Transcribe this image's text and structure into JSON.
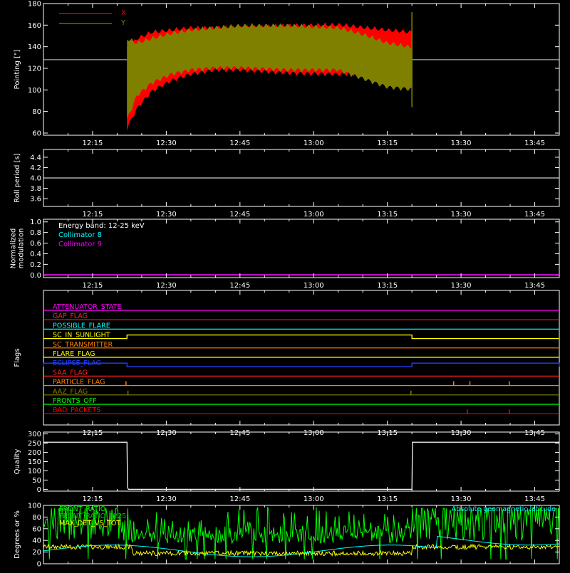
{
  "chart_data": [
    {
      "type": "area",
      "ylabel": "Pointing [\"]",
      "ylim": [
        58,
        180
      ],
      "yticks": [
        60,
        80,
        100,
        120,
        140,
        160,
        180
      ],
      "xlim_minutes": [
        0,
        105
      ],
      "xtick_labels": [
        "12:15",
        "12:30",
        "12:45",
        "13:00",
        "13:15",
        "13:30",
        "13:45"
      ],
      "xtick_minutes": [
        10,
        25,
        40,
        55,
        70,
        85,
        100
      ],
      "reference_line": 128,
      "data_span_minutes": [
        17,
        75
      ],
      "series": [
        {
          "name": "X",
          "color": "#ff0000",
          "x": [
            17,
            19,
            22,
            26,
            30,
            35,
            40,
            50,
            60,
            70,
            75
          ],
          "upper": [
            140,
            150,
            156,
            158,
            160,
            160,
            160,
            162,
            163,
            158,
            156
          ],
          "lower": [
            62,
            80,
            96,
            106,
            112,
            116,
            116,
            113,
            112,
            114,
            116
          ]
        },
        {
          "name": "Y",
          "color": "#808000",
          "x": [
            17,
            19,
            22,
            26,
            30,
            35,
            40,
            50,
            60,
            65,
            70,
            75
          ],
          "upper": [
            150,
            146,
            150,
            155,
            158,
            160,
            162,
            162,
            160,
            154,
            146,
            142
          ],
          "lower": [
            70,
            92,
            104,
            112,
            116,
            118,
            118,
            116,
            116,
            108,
            100,
            98
          ]
        }
      ]
    },
    {
      "type": "line",
      "ylabel": "Roll period [s]",
      "ylim": [
        3.45,
        4.55
      ],
      "yticks": [
        3.6,
        3.8,
        4.0,
        4.2,
        4.4
      ],
      "ytick_labels": [
        "3.6",
        "3.8",
        "4.0",
        "4.2",
        "4.4"
      ],
      "xtick_labels": [
        "12:15",
        "12:30",
        "12:45",
        "13:00",
        "13:15",
        "13:30",
        "13:45"
      ],
      "series": [
        {
          "name": "",
          "color": "#ffffff",
          "x": [
            0,
            105
          ],
          "values": [
            4.0,
            4.0
          ]
        }
      ]
    },
    {
      "type": "line",
      "ylabel": "Normalized modulation",
      "ylabel_lines": [
        "Normalized",
        "modulation"
      ],
      "ylim": [
        -0.05,
        1.05
      ],
      "yticks": [
        0.0,
        0.2,
        0.4,
        0.6,
        0.8,
        1.0
      ],
      "ytick_labels": [
        "0.0",
        "0.2",
        "0.4",
        "0.6",
        "0.8",
        "1.0"
      ],
      "xtick_labels": [
        "12:15",
        "12:30",
        "12:45",
        "13:00",
        "13:15",
        "13:30",
        "13:45"
      ],
      "legend_text": "Energy band: 12-25 keV",
      "series": [
        {
          "name": "Collimator 8",
          "color": "#00ffff",
          "x": [
            0,
            105
          ],
          "values": [
            0.0,
            0.0
          ]
        },
        {
          "name": "Collimator 9",
          "color": "#ff00ff",
          "x": [
            0,
            105
          ],
          "values": [
            0.0,
            0.0
          ]
        }
      ]
    },
    {
      "type": "line",
      "ylabel": "Flags",
      "xtick_labels": [
        "12:15",
        "12:30",
        "12:45",
        "13:00",
        "13:15",
        "13:30",
        "13:45"
      ],
      "flags": [
        {
          "name": "ATTENUATOR_STATE",
          "color": "#ff00ff",
          "on": []
        },
        {
          "name": "GAP_FLAG",
          "color": "#ff2020",
          "on": []
        },
        {
          "name": "POSSIBLE_FLARE",
          "color": "#00ffff",
          "on": []
        },
        {
          "name": "SC_IN_SUNLIGHT",
          "color": "#ffff00",
          "on": [
            [
              17,
              75
            ]
          ]
        },
        {
          "name": "SC_TRANSMITTER",
          "color": "#ff8000",
          "on": []
        },
        {
          "name": "FLARE_FLAG",
          "color": "#ffff00",
          "on": []
        },
        {
          "name": "ECLIPSE_FLAG",
          "color": "#2040ff",
          "on": [
            [
              0,
              17
            ],
            [
              75,
              105
            ]
          ]
        },
        {
          "name": "SAA_FLAG",
          "color": "#ff2020",
          "on": []
        },
        {
          "name": "PARTICLE_FLAG",
          "color": "#ff8000",
          "spikes": [
            16.8,
            83.5,
            86.8,
            94.8
          ]
        },
        {
          "name": "AAZ_FLAG",
          "color": "#808000",
          "spikes": [
            17.2,
            74.8
          ]
        },
        {
          "name": "FRONTS_OFF",
          "color": "#00ff00",
          "on": []
        },
        {
          "name": "BAD_PACKETS",
          "color": "#ff0000",
          "spikes": [
            86.3,
            94.8
          ]
        }
      ]
    },
    {
      "type": "line",
      "ylabel": "Quality",
      "ylim": [
        -10,
        310
      ],
      "yticks": [
        0,
        50,
        100,
        150,
        200,
        250,
        300
      ],
      "xtick_labels": [
        "12:15",
        "12:30",
        "12:45",
        "13:00",
        "13:15",
        "13:30",
        "13:45"
      ],
      "series": [
        {
          "name": "",
          "color": "#ffffff",
          "x": [
            0,
            17,
            17.1,
            17.3,
            75,
            75.1,
            105
          ],
          "values": [
            255,
            255,
            10,
            0,
            0,
            255,
            255
          ]
        }
      ]
    },
    {
      "type": "line",
      "ylabel": "Degrees or %",
      "ylim": [
        0,
        100
      ],
      "yticks": [
        0,
        20,
        40,
        60,
        80,
        100
      ],
      "series": [
        {
          "name": "FRONT_RATIO",
          "color": "#00ff00"
        },
        {
          "name": "FRONT_RATIO_1225",
          "color": "#00c000"
        },
        {
          "name": "MAX_DET_VS_TOT",
          "color": "#ffff00"
        },
        {
          "name": "Absolute geomagnetic latitude",
          "color": "#00ffff"
        }
      ]
    }
  ],
  "colors": {
    "frame": "#ffffff",
    "reference": "#ffffff"
  }
}
